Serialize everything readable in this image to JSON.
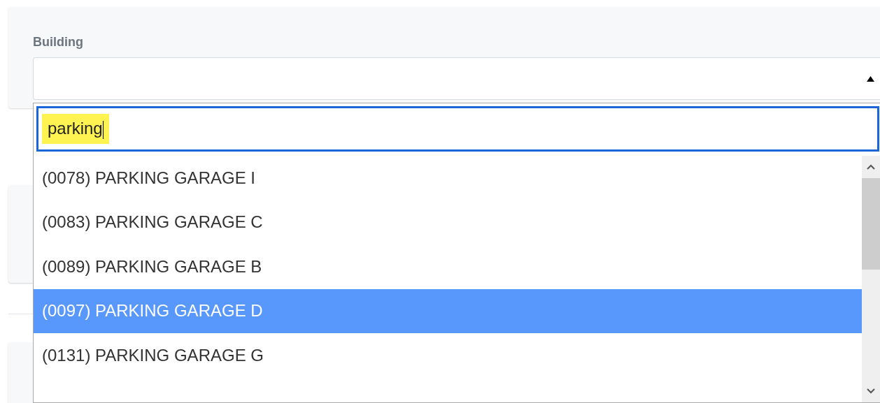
{
  "field": {
    "label": "Building",
    "expanded": true
  },
  "search": {
    "value": "parking",
    "highlighted": true
  },
  "options": [
    {
      "label": "(0078) PARKING GARAGE I",
      "selected": false
    },
    {
      "label": "(0083) PARKING GARAGE C",
      "selected": false
    },
    {
      "label": "(0089) PARKING GARAGE B",
      "selected": false
    },
    {
      "label": "(0097) PARKING GARAGE D",
      "selected": true
    },
    {
      "label": "(0131) PARKING GARAGE G",
      "selected": false
    }
  ]
}
